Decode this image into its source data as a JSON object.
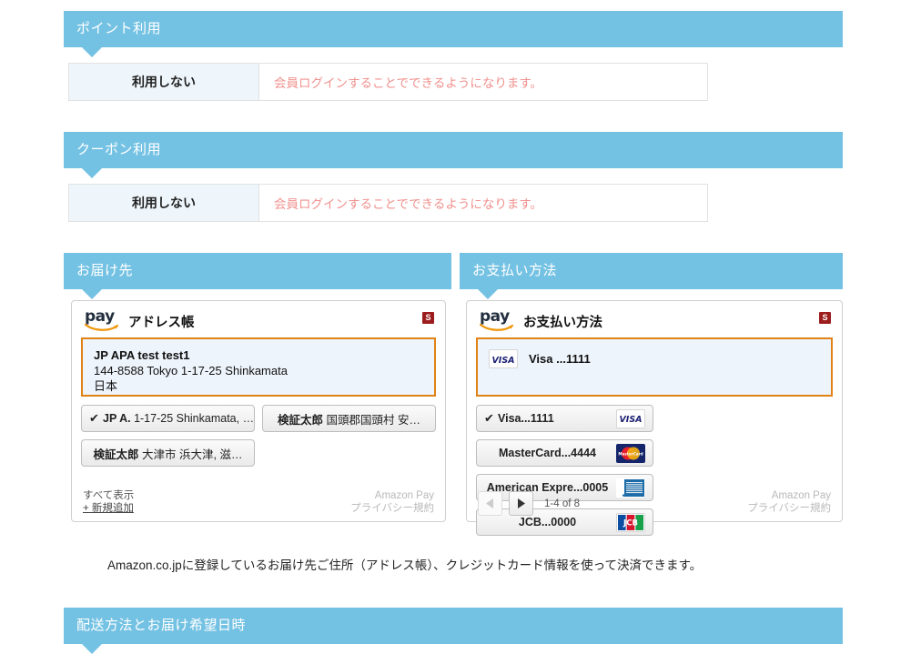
{
  "sections": [
    {
      "key": "points",
      "title": "ポイント利用",
      "label": "利用しない",
      "value": "会員ログインすることでできるようになります。"
    },
    {
      "key": "coupon",
      "title": "クーポン利用",
      "label": "利用しない",
      "value": "会員ログインすることでできるようになります。"
    }
  ],
  "shipping": {
    "header": "お届け先",
    "widget_title": "アドレス帳",
    "badge": "S",
    "selected": {
      "name": "JP APA test test1",
      "line1": "144-8588 Tokyo 1-17-25 Shinkamata",
      "line2": "日本"
    },
    "tiles": [
      {
        "checked": true,
        "bold": "JP A.",
        "rest": "1-17-25 Shinkamata, …"
      },
      {
        "checked": false,
        "bold": "検証太郎",
        "rest": "国頭郡国頭村 安…"
      },
      {
        "checked": false,
        "bold": "検証太郎",
        "rest": "大津市 浜大津, 滋…"
      }
    ],
    "footer": {
      "show_all": "すべて表示",
      "add_new": "+ 新規追加",
      "brand_line1": "Amazon Pay",
      "brand_line2": "プライバシー規約"
    }
  },
  "payment": {
    "header": "お支払い方法",
    "widget_title": "お支払い方法",
    "badge": "S",
    "selected": {
      "brand": "visa-icon",
      "label": "Visa ...1111"
    },
    "tiles": [
      {
        "checked": true,
        "label": "Visa...1111",
        "brand": "visa-icon"
      },
      {
        "checked": false,
        "label": "MasterCard...4444",
        "brand": "mastercard-icon"
      },
      {
        "checked": false,
        "label": "American Expre...0005",
        "brand": "amex-icon"
      },
      {
        "checked": false,
        "label": "JCB...0000",
        "brand": "jcb-icon"
      }
    ],
    "pager": {
      "prev": "prev-arrow-icon",
      "next": "next-arrow-icon",
      "count": "1-4 of 8"
    },
    "footer": {
      "brand_line1": "Amazon Pay",
      "brand_line2": "プライバシー規約"
    }
  },
  "note": "Amazon.co.jpに登録しているお届け先ご住所（アドレス帳）、クレジットカード情報を使って決済できます。",
  "shipping_method": {
    "header": "配送方法とお届け希望日時"
  },
  "colors": {
    "header_blue": "#74c2e3",
    "cell_blue": "#eff6fb",
    "accent_orange": "#e08214",
    "alert_pink": "#f0918e",
    "badge_red": "#9c1d1d"
  }
}
